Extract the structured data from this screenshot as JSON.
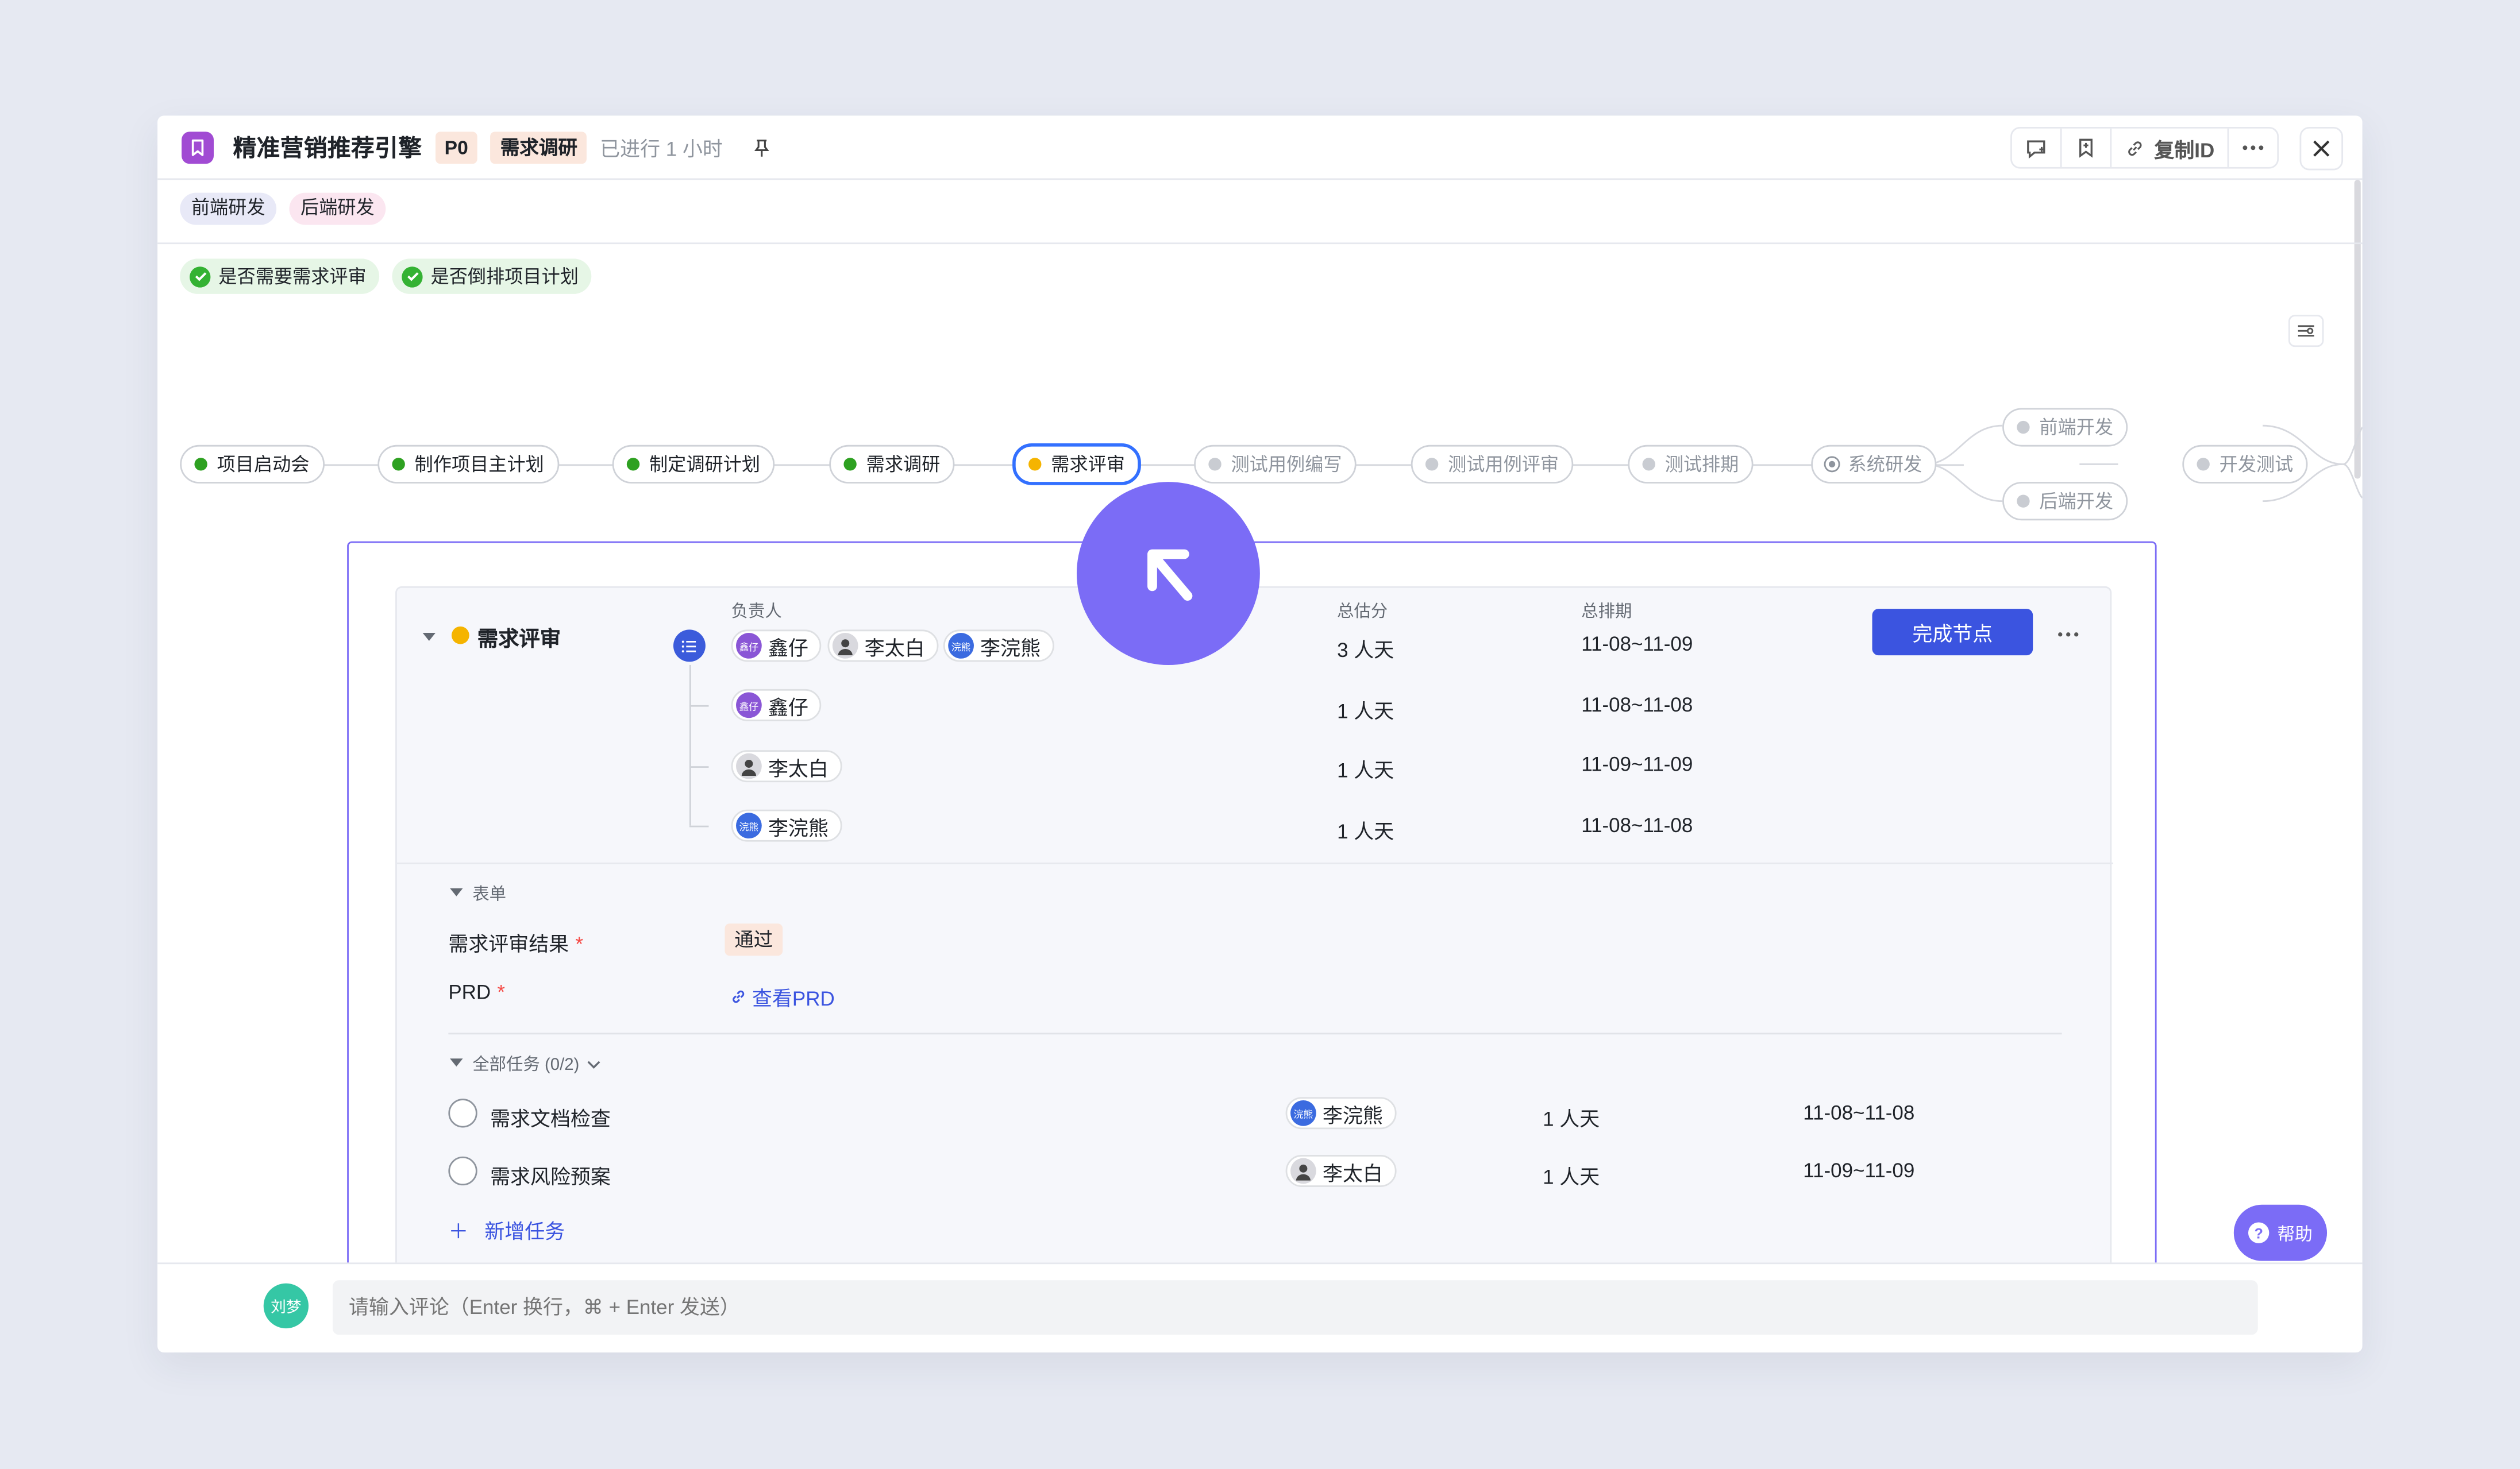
{
  "window": {
    "title": "精准营销推荐引擎",
    "priority": "P0",
    "phase": "需求调研",
    "elapsed": "已进行 1 小时",
    "copy_id_label": "复制ID"
  },
  "tags": [
    "前端研发",
    "后端研发"
  ],
  "checks": [
    "是否需要需求评审",
    "是否倒排项目计划"
  ],
  "flow": {
    "nodes": [
      {
        "label": "项目启动会",
        "state": "done"
      },
      {
        "label": "制作项目主计划",
        "state": "done"
      },
      {
        "label": "制定调研计划",
        "state": "done"
      },
      {
        "label": "需求调研",
        "state": "done"
      },
      {
        "label": "需求评审",
        "state": "active"
      },
      {
        "label": "测试用例编写",
        "state": "todo"
      },
      {
        "label": "测试用例评审",
        "state": "todo"
      },
      {
        "label": "测试排期",
        "state": "todo"
      },
      {
        "label": "系统研发",
        "state": "sys"
      },
      {
        "label": "前端开发",
        "state": "todo"
      },
      {
        "label": "后端开发",
        "state": "todo"
      },
      {
        "label": "开发测试",
        "state": "todo"
      }
    ]
  },
  "node_detail": {
    "title": "需求评审",
    "headers": {
      "owner": "负责人",
      "estimate": "总估分",
      "schedule": "总排期"
    },
    "summary": {
      "owners": [
        {
          "name": "鑫仔",
          "avatar": "鑫仔"
        },
        {
          "name": "李太白",
          "avatar": ""
        },
        {
          "name": "李浣熊",
          "avatar": "浣熊"
        }
      ],
      "estimate": "3 人天",
      "schedule": "11-08~11-09"
    },
    "rows": [
      {
        "owner": "鑫仔",
        "avatar": "鑫仔",
        "estimate": "1 人天",
        "schedule": "11-08~11-08"
      },
      {
        "owner": "李太白",
        "avatar": "",
        "estimate": "1 人天",
        "schedule": "11-09~11-09"
      },
      {
        "owner": "李浣熊",
        "avatar": "浣熊",
        "estimate": "1 人天",
        "schedule": "11-08~11-08"
      }
    ],
    "complete_button": "完成节点",
    "form_title": "表单",
    "fields": [
      {
        "label": "需求评审结果",
        "value": "通过"
      },
      {
        "label": "PRD",
        "value": "查看PRD"
      }
    ],
    "tasks_title": "全部任务 (0/2)",
    "tasks": [
      {
        "name": "需求文档检查",
        "owner": "李浣熊",
        "avatar": "浣熊",
        "estimate": "1 人天",
        "schedule": "11-08~11-08"
      },
      {
        "name": "需求风险预案",
        "owner": "李太白",
        "avatar": "",
        "estimate": "1 人天",
        "schedule": "11-09~11-09"
      }
    ],
    "add_task": "新增任务"
  },
  "comment": {
    "user": "刘梦",
    "placeholder": "请输入评论（Enter 换行，⌘ + Enter 发送）"
  },
  "help_label": "帮助",
  "colors": {
    "accent": "#7b6cf6",
    "primary": "#3b54e0",
    "done": "#2ea121",
    "active": "#f5b400"
  }
}
